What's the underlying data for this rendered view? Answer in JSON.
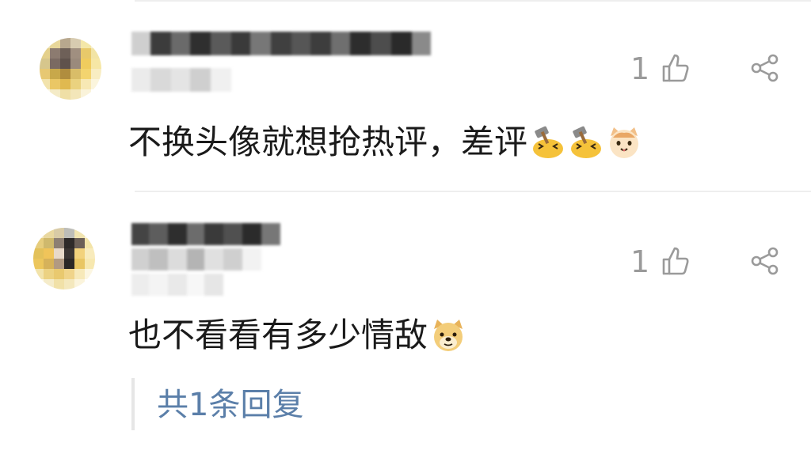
{
  "comments": [
    {
      "text": "不换头像就想抢热评，差评",
      "emojis": [
        "hammer-emoji",
        "hammer-emoji",
        "cat-face-emoji"
      ],
      "like_count": "1",
      "icons": {
        "like": "thumbs-up-icon",
        "share": "share-icon"
      }
    },
    {
      "text": "也不看看有多少情敌",
      "emojis": [
        "doge-emoji"
      ],
      "like_count": "1",
      "icons": {
        "like": "thumbs-up-icon",
        "share": "share-icon"
      },
      "reply_link": "共1条回复"
    }
  ],
  "colors": {
    "text": "#1a1a1a",
    "muted": "#9a9a9a",
    "link": "#5b7fa9",
    "divider": "#eeeeee"
  }
}
